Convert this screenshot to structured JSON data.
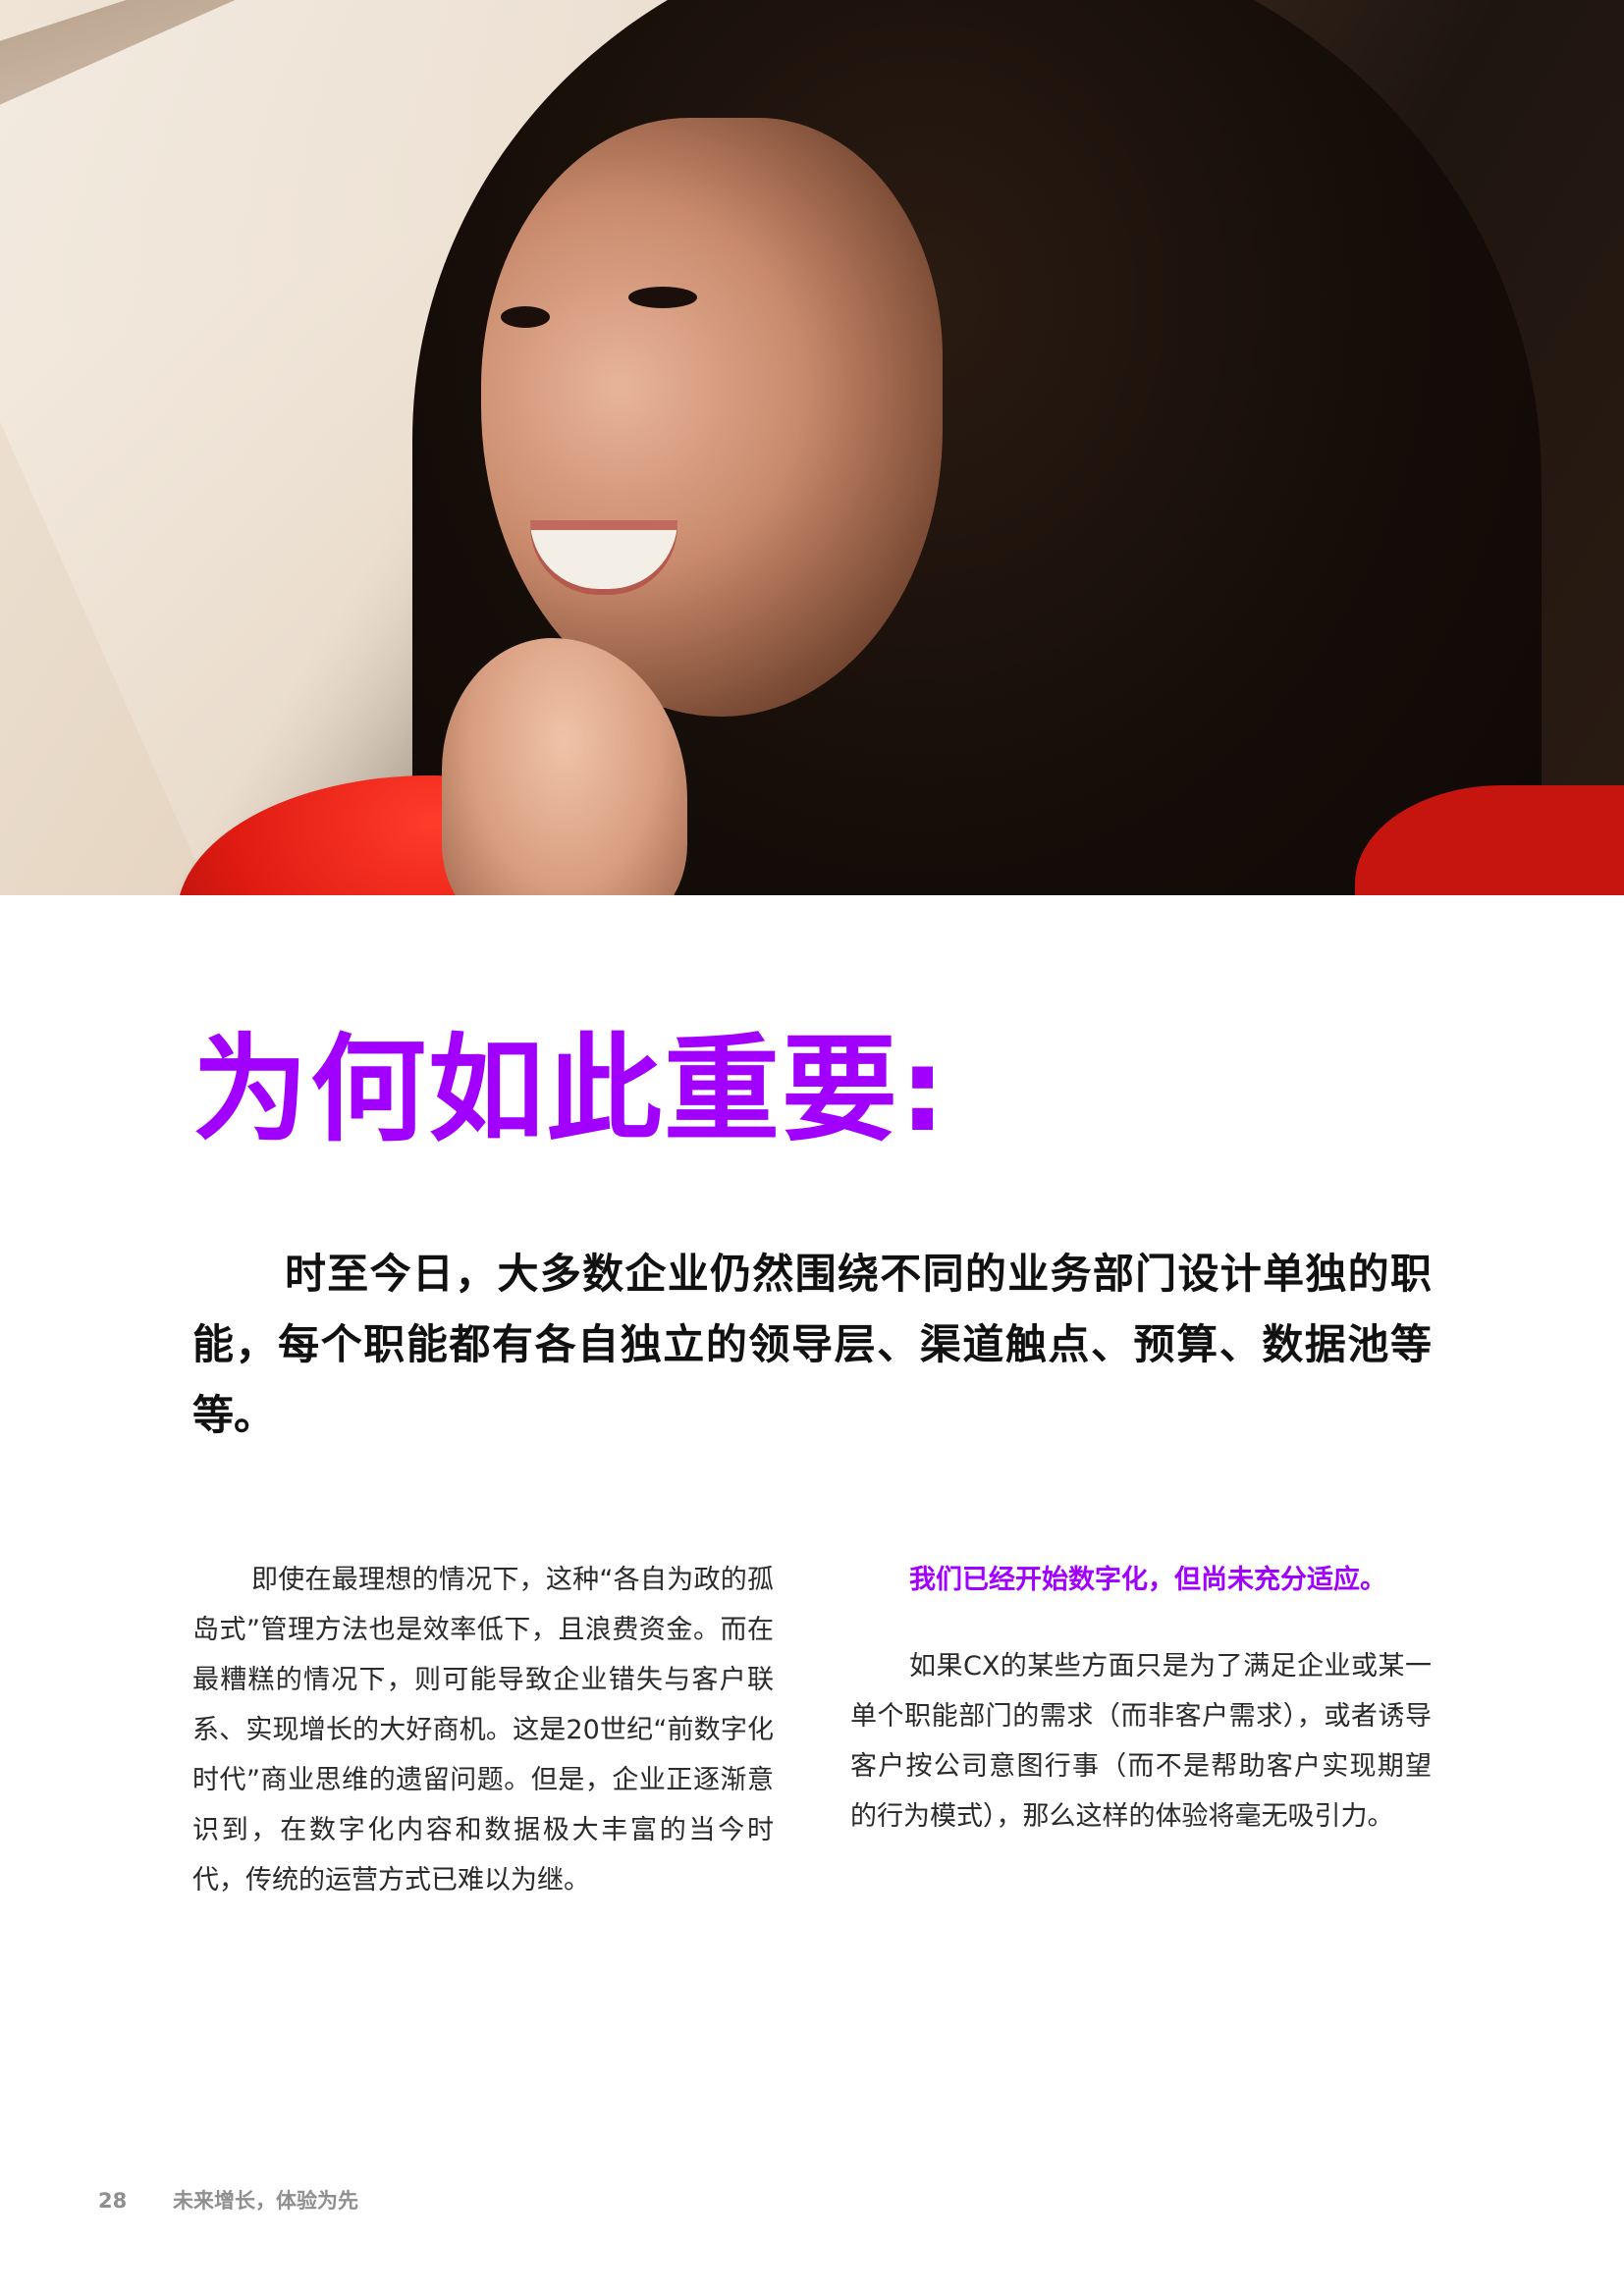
{
  "hero": {
    "alt": "人物照片"
  },
  "headline": "为何如此重要:",
  "lead": "时至今日，大多数企业仍然围绕不同的业务部门设计单独的职能，每个职能都有各自独立的领导层、渠道触点、预算、数据池等等。",
  "left_column": {
    "paragraph": "即使在最理想的情况下，这种“各自为政的孤岛式”管理方法也是效率低下，且浪费资金。而在最糟糕的情况下，则可能导致企业错失与客户联系、实现增长的大好商机。这是20世纪“前数字化时代”商业思维的遗留问题。但是，企业正逐渐意识到，在数字化内容和数据极大丰富的当今时代，传统的运营方式已难以为继。"
  },
  "right_column": {
    "heading": "我们已经开始数字化，但尚未充分适应。",
    "paragraph": "如果CX的某些方面只是为了满足企业或某一单个职能部门的需求（而非客户需求），或者诱导客户按公司意图行事（而不是帮助客户实现期望的行为模式），那么这样的体验将毫无吸引力。"
  },
  "footer": {
    "page_number": "28",
    "title": "未来增长，体验为先"
  },
  "colors": {
    "accent": "#a100ff",
    "body_text": "#2a2a2a",
    "footer_text": "#8f8f8f"
  }
}
